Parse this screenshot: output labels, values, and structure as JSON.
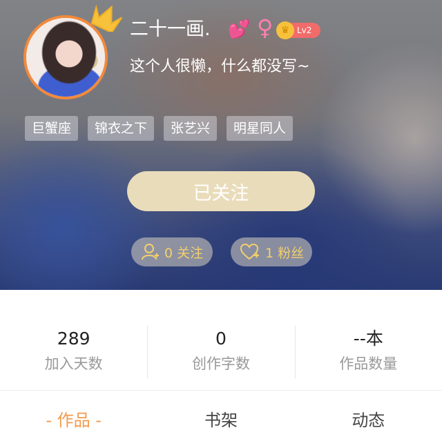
{
  "profile": {
    "nickname": "二十一画.",
    "heart_icon": "heart-icon",
    "gender_symbol": "♀",
    "level": "Lv2",
    "signature": "这个人很懒，什么都没写~"
  },
  "tags": [
    "巨蟹座",
    "锦衣之下",
    "张艺兴",
    "明星同人"
  ],
  "follow_button": {
    "label": "已关注"
  },
  "social": {
    "following_label": "0 关注",
    "fans_label": "1 粉丝"
  },
  "stats": [
    {
      "value": "289",
      "label": "加入天数"
    },
    {
      "value": "0",
      "label": "创作字数"
    },
    {
      "value": "--本",
      "label": "作品数量"
    }
  ],
  "tabs": [
    {
      "label": "- 作品 -",
      "active": true
    },
    {
      "label": "书架",
      "active": false
    },
    {
      "label": "动态",
      "active": false
    }
  ],
  "colors": {
    "accent": "#f39a4c",
    "avatar_border": "#f28a3c",
    "crown": "#f7c13b",
    "level_badge": "#f26b6b",
    "follow_button": "#e9dcba",
    "social_text": "#f4d06c"
  }
}
